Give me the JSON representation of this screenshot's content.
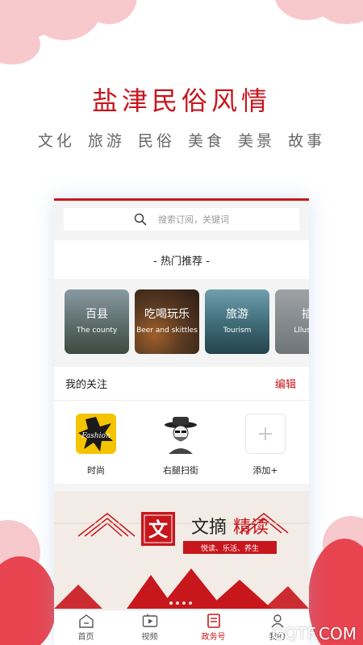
{
  "hero": {
    "title": "盐津民俗风情",
    "subtitle": "文化 旅游 民俗 美食 美景 故事"
  },
  "search": {
    "placeholder": "搜索订阅，关键词"
  },
  "hot": {
    "label": "- 热门推荐 -"
  },
  "cards": [
    {
      "cn": "百县",
      "en": "The county",
      "color": "#5a6b73"
    },
    {
      "cn": "吃喝玩乐",
      "en": "Beer and skittles",
      "color": "#4a3326"
    },
    {
      "cn": "旅游",
      "en": "Tourism",
      "color": "#3d6a78"
    },
    {
      "cn": "插",
      "en": "Lllustra",
      "color": "#7a7d80"
    }
  ],
  "follow": {
    "title": "我的关注",
    "edit": "编辑",
    "items": [
      {
        "label": "时尚",
        "icon": "fashion-icon",
        "badge": "Fashion"
      },
      {
        "label": "右腿扫街",
        "icon": "cowboy-avatar-icon"
      },
      {
        "label": "添加+",
        "icon": "plus-icon"
      }
    ]
  },
  "banner": {
    "logo_char": "文",
    "title_a": "文摘",
    "title_b": "精读",
    "tagline": "悦读、乐活、养生"
  },
  "tabs": [
    {
      "label": "首页",
      "icon": "home-icon",
      "active": false
    },
    {
      "label": "视频",
      "icon": "video-icon",
      "active": false
    },
    {
      "label": "政务号",
      "icon": "gov-icon",
      "active": true
    },
    {
      "label": "我的",
      "icon": "user-icon",
      "active": false
    }
  ],
  "watermark": "GQTF.COM",
  "colors": {
    "accent": "#c8161d",
    "cloud": "#f7c9cd",
    "cloud_dark": "#e84450"
  }
}
